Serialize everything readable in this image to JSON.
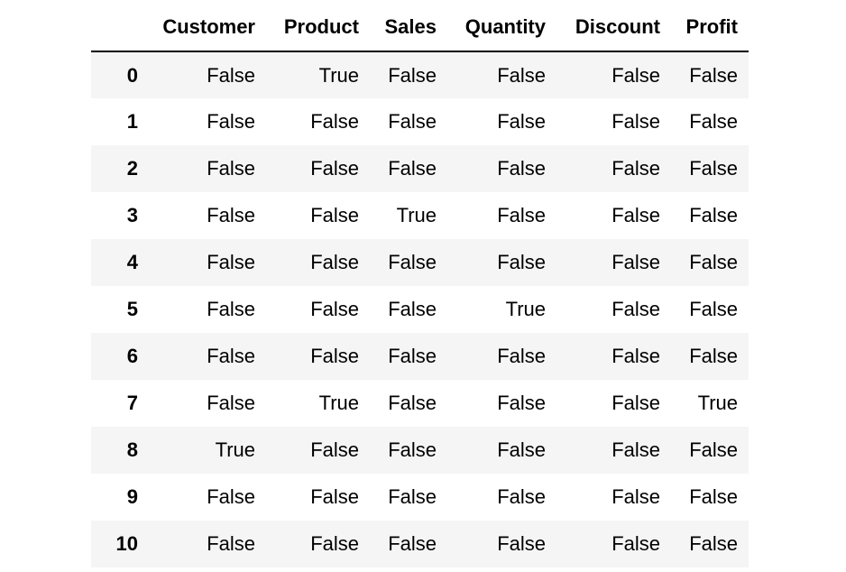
{
  "table": {
    "index_header": "",
    "columns": [
      "Customer",
      "Product",
      "Sales",
      "Quantity",
      "Discount",
      "Profit"
    ],
    "rows": [
      {
        "index": "0",
        "cells": [
          "False",
          "True",
          "False",
          "False",
          "False",
          "False"
        ]
      },
      {
        "index": "1",
        "cells": [
          "False",
          "False",
          "False",
          "False",
          "False",
          "False"
        ]
      },
      {
        "index": "2",
        "cells": [
          "False",
          "False",
          "False",
          "False",
          "False",
          "False"
        ]
      },
      {
        "index": "3",
        "cells": [
          "False",
          "False",
          "True",
          "False",
          "False",
          "False"
        ]
      },
      {
        "index": "4",
        "cells": [
          "False",
          "False",
          "False",
          "False",
          "False",
          "False"
        ]
      },
      {
        "index": "5",
        "cells": [
          "False",
          "False",
          "False",
          "True",
          "False",
          "False"
        ]
      },
      {
        "index": "6",
        "cells": [
          "False",
          "False",
          "False",
          "False",
          "False",
          "False"
        ]
      },
      {
        "index": "7",
        "cells": [
          "False",
          "True",
          "False",
          "False",
          "False",
          "True"
        ]
      },
      {
        "index": "8",
        "cells": [
          "True",
          "False",
          "False",
          "False",
          "False",
          "False"
        ]
      },
      {
        "index": "9",
        "cells": [
          "False",
          "False",
          "False",
          "False",
          "False",
          "False"
        ]
      },
      {
        "index": "10",
        "cells": [
          "False",
          "False",
          "False",
          "False",
          "False",
          "False"
        ]
      }
    ]
  },
  "colors": {
    "stripe_row": "#f5f5f5",
    "plain_row": "#ffffff",
    "header_rule": "#000000",
    "text": "#000000"
  }
}
